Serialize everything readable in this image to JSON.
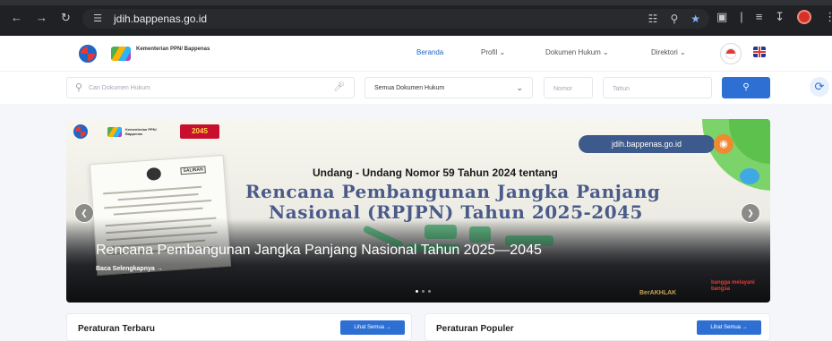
{
  "browser": {
    "url": "jdih.bappenas.go.id"
  },
  "header": {
    "logo_text": "Kementerian PPN/ Bappenas",
    "nav": [
      {
        "label": "Beranda",
        "active": true
      },
      {
        "label": "Profil",
        "dropdown": true
      },
      {
        "label": "Dokumen Hukum",
        "dropdown": true
      },
      {
        "label": "Direktori",
        "dropdown": true
      }
    ]
  },
  "search": {
    "placeholder": "Cari Dokumen Hukum",
    "category_selected": "Semua Dokumen Hukum",
    "nomor_placeholder": "Nomor",
    "tahun_placeholder": "Tahun"
  },
  "banner": {
    "logo_text": "Kementerian PPN/ Bappenas",
    "badge_year": "2045",
    "doc_stamp": "SALINAN",
    "site_pill": "jdih.bappenas.go.id",
    "headline_small": "Undang - Undang Nomor 59 Tahun 2024 tentang",
    "headline_line1": "Rencana Pembangunan Jangka Panjang",
    "headline_line2": "Nasional (RPJPN) Tahun 2025-2045",
    "title": "Rencana Pembangunan Jangka Panjang Nasional Tahun 2025—2045",
    "read_more": "Baca Selengkapnya →",
    "footer_brand": "BerAKHLAK",
    "footer_tag": "bangga melayani bangsa",
    "slide_count": 3,
    "active_slide": 1
  },
  "sections": [
    {
      "title": "Peraturan Terbaru",
      "see_all": "Lihat Semua →"
    },
    {
      "title": "Peraturan Populer",
      "see_all": "Lihat Semua →"
    }
  ],
  "colors": {
    "accent": "#2d6fd3",
    "headline": "#4a5b8a"
  }
}
